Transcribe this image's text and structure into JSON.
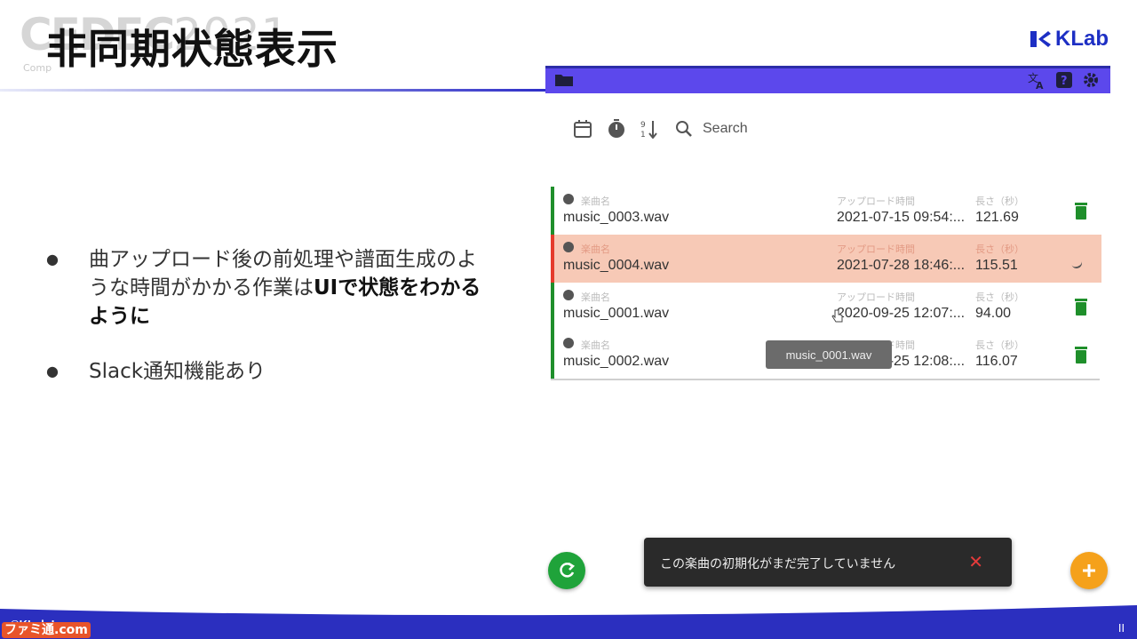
{
  "slide": {
    "title": "非同期状態表示",
    "conference_logo": "CEDEC",
    "conference_year": "2021",
    "conference_sub": "Comp",
    "company_logo": "KLab",
    "copyright": "©KLab Inc.",
    "pager": "II",
    "watermark": "ファミ通.com"
  },
  "bullets": [
    {
      "pre": "曲アップロード後の前処理や譜面生成のような時間がかかる作業は",
      "bold": "UIで状態をわかるように"
    },
    {
      "pre": "Slack通知機能あり",
      "bold": ""
    }
  ],
  "app": {
    "colors": {
      "bar": "#5c48ec",
      "ok": "#1f8f2b",
      "error": "#e53b2b",
      "error_bg": "#f7c9b6",
      "fab_add": "#f5a11b",
      "fab_refresh": "#1fa33a"
    },
    "header_icons": [
      "folder-icon",
      "translate-icon",
      "help-icon",
      "settings-icon"
    ],
    "toolbar": {
      "search_label": "Search",
      "icons": [
        "calendar-icon",
        "timer-icon",
        "sort-icon",
        "search-icon"
      ]
    },
    "columns": {
      "name": "楽曲名",
      "uploaded": "アップロード時間",
      "length": "長さ（秒）"
    },
    "rows": [
      {
        "name": "music_0003.wav",
        "uploaded": "2021-07-15 09:54:...",
        "length": "121.69",
        "status": "ok"
      },
      {
        "name": "music_0004.wav",
        "uploaded": "2021-07-28 18:46:...",
        "length": "115.51",
        "status": "error"
      },
      {
        "name": "music_0001.wav",
        "uploaded": "2020-09-25 12:07:...",
        "length": "94.00",
        "status": "ok"
      },
      {
        "name": "music_0002.wav",
        "uploaded": "2020-09-25 12:08:...",
        "length": "116.07",
        "status": "ok"
      }
    ],
    "tooltip": "music_0001.wav",
    "snackbar": {
      "message": "この楽曲の初期化がまだ完了していません",
      "close": "✕"
    }
  }
}
